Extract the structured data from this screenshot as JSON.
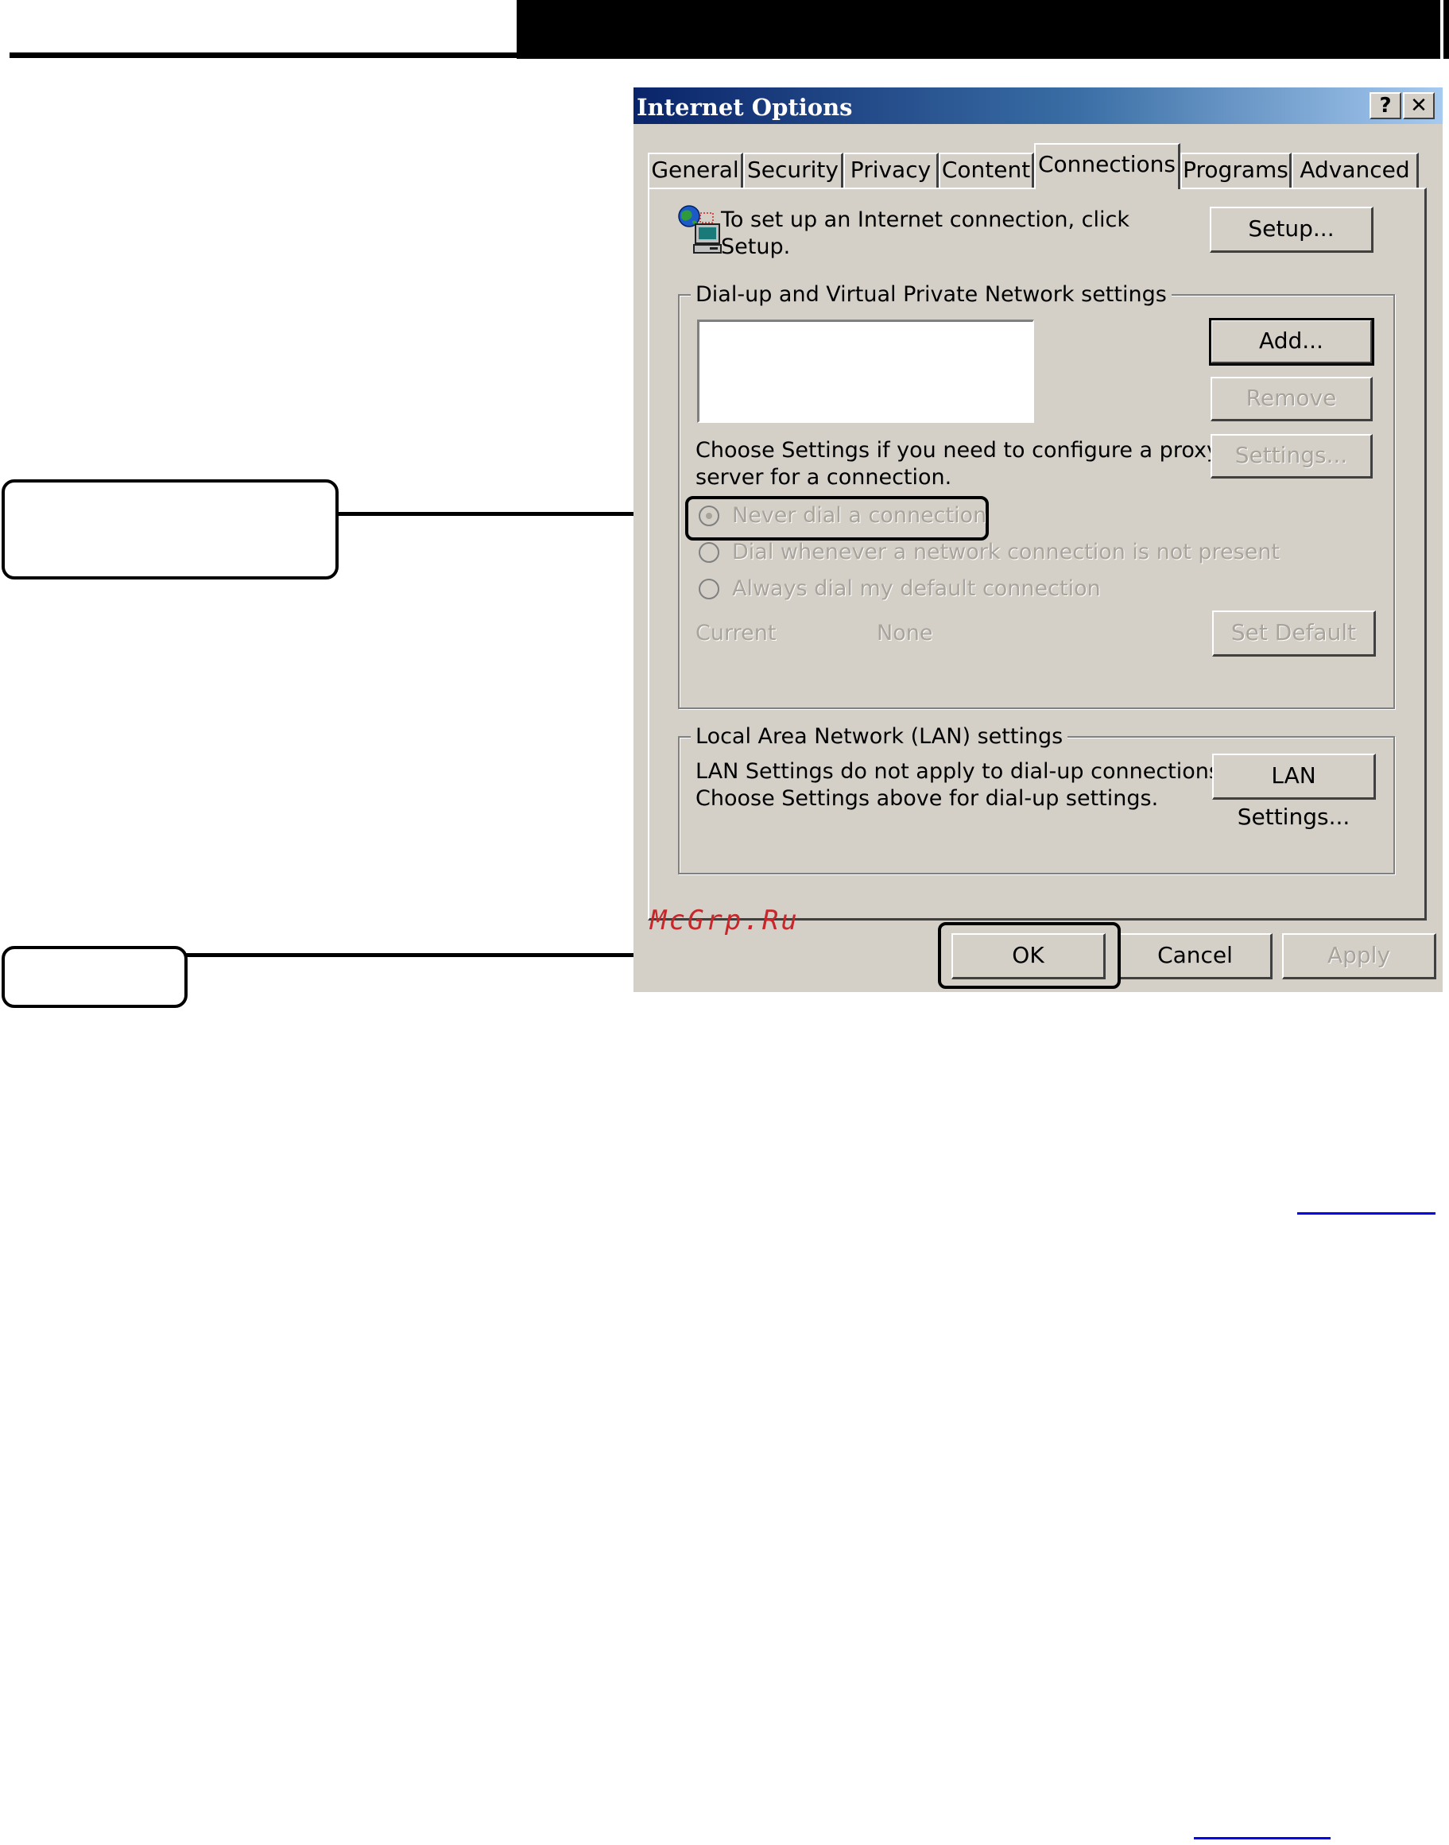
{
  "dialog": {
    "title": "Internet Options",
    "help_button": "?",
    "close_button": "✕",
    "tabs": [
      {
        "label": "General"
      },
      {
        "label": "Security"
      },
      {
        "label": "Privacy"
      },
      {
        "label": "Content"
      },
      {
        "label": "Connections",
        "active": true
      },
      {
        "label": "Programs"
      },
      {
        "label": "Advanced"
      }
    ],
    "setup": {
      "icon": "network-globe-computer-icon",
      "text_line1": "To set up an Internet connection, click",
      "text_line2": "Setup.",
      "button": "Setup..."
    },
    "dialup_group": {
      "legend": "Dial-up and Virtual Private Network settings",
      "add_button": "Add...",
      "remove_button": "Remove",
      "settings_button": "Settings...",
      "proxy_text_line1": "Choose Settings if you need to configure a proxy",
      "proxy_text_line2": "server for a connection.",
      "radio_options": [
        {
          "label": "Never dial a connection",
          "selected": true
        },
        {
          "label": "Dial whenever a network connection is not present",
          "selected": false
        },
        {
          "label": "Always dial my default connection",
          "selected": false
        }
      ],
      "current_label": "Current",
      "current_value": "None",
      "set_default_button": "Set Default"
    },
    "lan_group": {
      "legend": "Local Area Network (LAN) settings",
      "text_line1": "LAN Settings do not apply to dial-up connections.",
      "text_line2": "Choose Settings above for dial-up settings.",
      "button": "LAN Settings..."
    },
    "footer": {
      "ok": "OK",
      "cancel": "Cancel",
      "apply": "Apply"
    }
  },
  "watermark": "McGrp.Ru"
}
